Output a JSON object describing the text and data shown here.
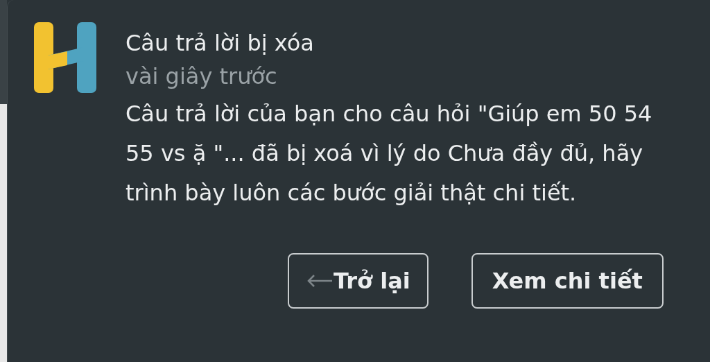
{
  "notification": {
    "title": "Câu trả lời bị xóa",
    "time": "vài giây trước",
    "message": "Câu trả lời của bạn cho câu hỏi \"Giúp em 50 54 55 vs ặ \"... đã bị xoá vì lý do Chưa đầy đủ, hãy trình bày luôn các bước giải thật chi tiết.",
    "buttons": [
      {
        "label": "Trở lại",
        "kind": "back"
      },
      {
        "label": "Xem chi tiết",
        "kind": "plain"
      }
    ]
  }
}
